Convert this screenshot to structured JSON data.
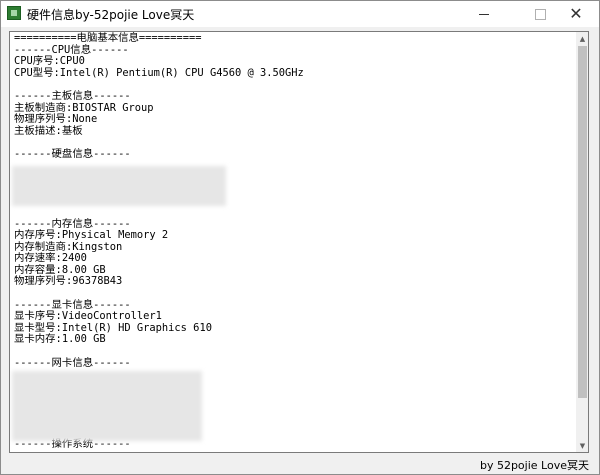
{
  "window": {
    "title": "硬件信息by-52pojie Love冥天",
    "icon": "app-icon"
  },
  "controls": {
    "minimize": "minimize-icon",
    "maximize": "maximize-icon",
    "close_glyph": "✕"
  },
  "content": {
    "lines": [
      "==========电脑基本信息==========",
      "------CPU信息------",
      "CPU序号:CPU0",
      "CPU型号:Intel(R) Pentium(R) CPU G4560 @ 3.50GHz",
      "",
      "------主板信息------",
      "主板制造商:BIOSTAR Group",
      "物理序列号:None",
      "主板描述:基板",
      "",
      "------硬盘信息------",
      "",
      "",
      "",
      "",
      "",
      "------内存信息------",
      "内存序号:Physical Memory 2",
      "内存制造商:Kingston",
      "内存速率:2400",
      "内存容量:8.00 GB",
      "物理序列号:96378B43",
      "",
      "------显卡信息------",
      "显卡序号:VideoController1",
      "显卡型号:Intel(R) HD Graphics 610",
      "显卡内存:1.00 GB",
      "",
      "------网卡信息------",
      "",
      "",
      "",
      "",
      "",
      "",
      "------操作系统------"
    ]
  },
  "status": {
    "text": "by 52pojie Love冥天"
  },
  "scrollbar": {
    "up_glyph": "▲",
    "down_glyph": "▼"
  }
}
